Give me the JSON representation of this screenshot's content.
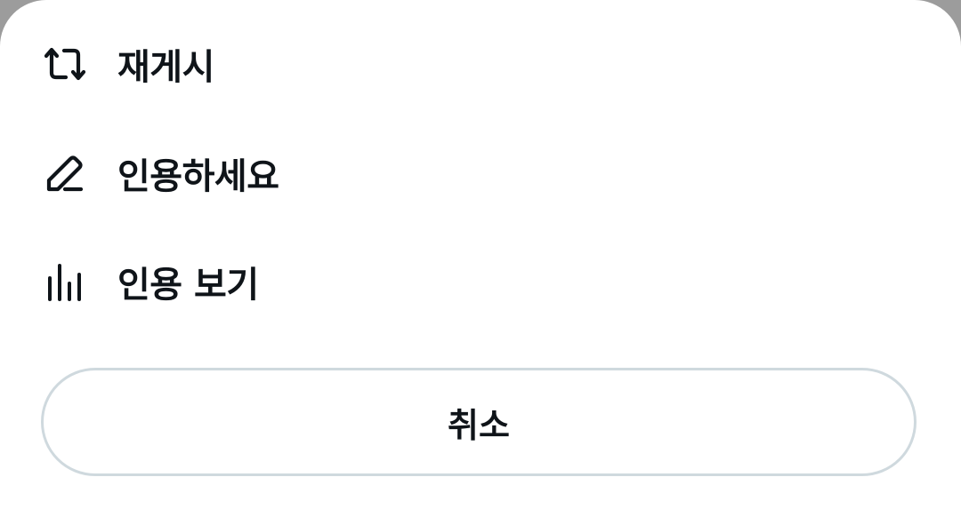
{
  "menu": {
    "items": [
      {
        "label": "재게시",
        "icon": "repost-icon"
      },
      {
        "label": "인용하세요",
        "icon": "pencil-icon"
      },
      {
        "label": "인용 보기",
        "icon": "bar-chart-icon"
      }
    ]
  },
  "cancel": {
    "label": "취소"
  },
  "colors": {
    "text": "#0f1419",
    "border": "#cfd9de",
    "sheet": "#ffffff",
    "backdrop": "#9c9c9c"
  }
}
